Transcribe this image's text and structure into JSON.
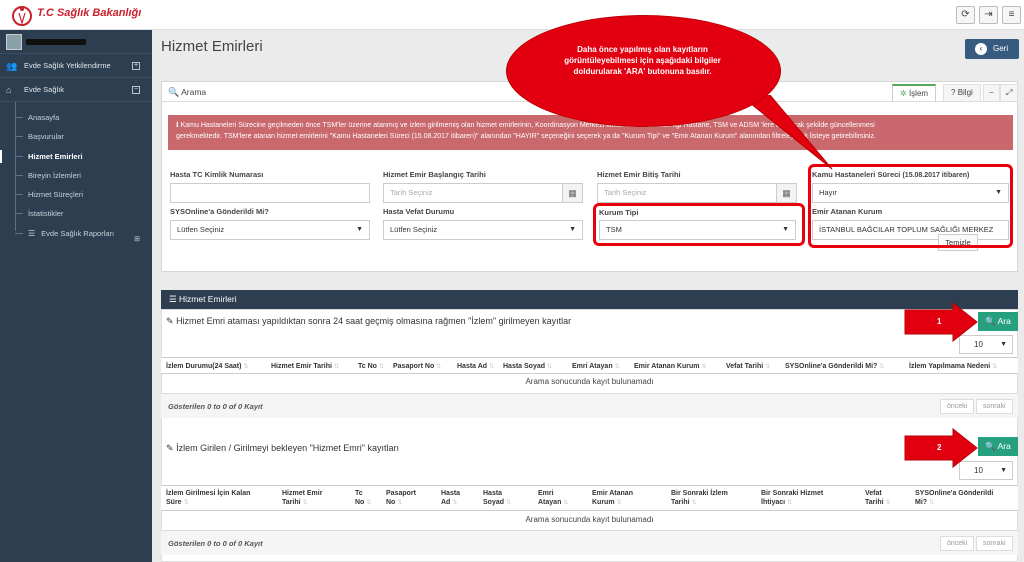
{
  "header": {
    "logo_text": "T.C Sağlık Bakanlığı",
    "buttons": [
      "refresh-icon",
      "logout-icon",
      "menu-icon"
    ]
  },
  "sidebar": {
    "items": [
      {
        "label": "Evde Sağlık Yetkilendirme",
        "icon": "users-icon",
        "toggle": "+"
      },
      {
        "label": "Evde Sağlık",
        "icon": "home-icon",
        "toggle": "−"
      }
    ],
    "subitems": [
      "Anasayfa",
      "Başvurular",
      "Hizmet Emirleri",
      "Bireyin İzlemleri",
      "Hizmet Süreçleri",
      "İstatistikler",
      "Evde Sağlık Raporları"
    ],
    "active_index": 2
  },
  "page": {
    "title": "Hizmet Emirleri",
    "back_label": "Geri"
  },
  "search": {
    "title": "Arama",
    "tab_islem": "İşlem",
    "tab_bilgi": "Bilgi",
    "alert_line1": "Kamu Hastaneleri Sürecine geçilmeden önce TSM'ler üzerine atanmış ve izlem girilmemiş olan hizmet emirlerinin, Koordinasyon Merkezi kullanıcısı tarafından ilgi Hastane, TSM ve ADSM 'lere atanacak şekilde güncellenmesi",
    "alert_line2": "gerekmektedir. TSM'lere atanan hizmet emirlerini \"Kamu Hastaneleri Süreci (15.08.2017 itibaren)\" alanından \"HAYIR\" seçeneğini seçerek ya da \"Kurum Tipi\" ve \"Emir Atanan Kurum\" alanından filtreleyerek listeye getirebilirsiniz.",
    "fields": {
      "tc_label": "Hasta TC Kimlik Numarası",
      "start_label": "Hizmet Emir Başlangıç Tarihi",
      "start_placeholder": "Tarih Seçiniz",
      "end_label": "Hizmet Emir Bitiş Tarihi",
      "end_placeholder": "Tarih Seçiniz",
      "kamu_label": "Kamu Hastaneleri Süreci",
      "kamu_label_suffix": "(15.08.2017 itibaren)",
      "kamu_value": "Hayır",
      "sys_label": "SYSOnline'a Gönderildi Mi?",
      "sys_value": "Lütfen Seçiniz",
      "vefat_label": "Hasta Vefat Durumu",
      "vefat_value": "Lütfen Seçiniz",
      "kurum_tipi_label": "Kurum Tipi",
      "kurum_tipi_value": "TSM",
      "emir_kurum_label": "Emir Atanan Kurum",
      "emir_kurum_value": "İSTANBUL BAĞCILAR TOPLUM SAĞLIĞI MERKEZ"
    },
    "clear_label": "Temizle"
  },
  "callout": {
    "text": "Daha önce  yapılmış olan kayıtların görüntüleyebilmesi için aşağıdaki bilgiler doldurularak 'ARA' butonuna basılır."
  },
  "results": {
    "title": "Hizmet Emirleri",
    "search_label": "Ara",
    "page_size": "10",
    "empty_text": "Arama sonucunda kayıt bulunamadı",
    "footer_info": "Gösterilen 0 to 0 of 0 Kayıt",
    "prev_label": "önceki",
    "next_label": "sonraki",
    "section1": {
      "title": "Hizmet Emri ataması yapıldıktan sonra 24 saat geçmiş olmasına rağmen \"İzlem\" girilmeyen kayıtlar",
      "arrow_number": "1",
      "columns": [
        "İzlem Durumu(24 Saat)",
        "Hizmet Emir Tarihi",
        "Tc No",
        "Pasaport No",
        "Hasta Ad",
        "Hasta Soyad",
        "Emri Atayan",
        "Emir Atanan Kurum",
        "Vefat Tarihi",
        "SYSOnline'a Gönderildi Mi?",
        "İzlem Yapılmama Nedeni"
      ]
    },
    "section2": {
      "title": "İzlem Girilen / Girilmeyi bekleyen \"Hizmet Emri\" kayıtları",
      "arrow_number": "2",
      "columns": [
        "İzlem Girilmesi İçin Kalan Süre",
        "Hizmet Emir Tarihi",
        "Tc No",
        "Pasaport No",
        "Hasta Ad",
        "Hasta Soyad",
        "Emri Atayan",
        "Emir Atanan Kurum",
        "Bir Sonraki İzlem Tarihi",
        "Bir Sonraki Hizmet İhtiyacı",
        "Vefat Tarihi",
        "SYSOnline'a Gönderildi Mi?"
      ]
    }
  },
  "colors": {
    "sidebar": "#2c3e50",
    "accent_green": "#27a080",
    "alert_red": "#c9696e",
    "callout_red": "#e20010",
    "back_button": "#375a7f"
  }
}
